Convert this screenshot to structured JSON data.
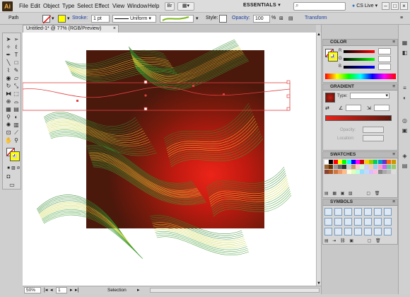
{
  "menubar": {
    "app_icon": "Ai",
    "items": [
      "File",
      "Edit",
      "Object",
      "Type",
      "Select",
      "Effect",
      "View",
      "Window",
      "Help"
    ],
    "workspace": "ESSENTIALS",
    "search_placeholder": "",
    "cs_live": "CS Live"
  },
  "controlbar": {
    "selection_type": "Path",
    "stroke_label": "Stroke:",
    "stroke_weight": "1 pt",
    "profile": "Uniform",
    "style_label": "Style:",
    "opacity_label": "Opacity:",
    "opacity_value": "100",
    "opacity_unit": "%",
    "transform_label": "Transform",
    "colors": {
      "fill": "#ffffff",
      "stroke": "#ffff00"
    }
  },
  "document": {
    "tab_title": "Untitled-1* @ 77% (RGB/Preview)",
    "close": "×"
  },
  "status": {
    "zoom": "50%",
    "page": "1",
    "mode": "Selection"
  },
  "panels": {
    "color": {
      "title": "COLOR",
      "channels": [
        "R",
        "G",
        "B"
      ]
    },
    "gradient": {
      "title": "GRADIENT",
      "type_label": "Type:",
      "type_value": "",
      "angle_value": "",
      "opacity_label": "Opacity:",
      "location_label": "Location:"
    },
    "swatches": {
      "title": "SWATCHES"
    },
    "symbols": {
      "title": "SYMBOLS"
    }
  },
  "icons": {
    "tools": [
      "selection-tool-icon",
      "direct-selection-tool-icon",
      "magic-wand-icon",
      "lasso-icon",
      "pen-tool-icon",
      "type-tool-icon",
      "line-tool-icon",
      "rectangle-tool-icon",
      "paintbrush-icon",
      "pencil-icon",
      "blob-brush-icon",
      "eraser-icon",
      "rotate-tool-icon",
      "scale-tool-icon",
      "width-tool-icon",
      "free-transform-icon",
      "shape-builder-icon",
      "perspective-grid-icon",
      "mesh-tool-icon",
      "gradient-tool-icon",
      "eyedropper-icon",
      "blend-tool-icon",
      "symbol-sprayer-icon",
      "column-graph-icon",
      "artboard-tool-icon",
      "slice-tool-icon",
      "hand-tool-icon",
      "zoom-tool-icon"
    ]
  }
}
